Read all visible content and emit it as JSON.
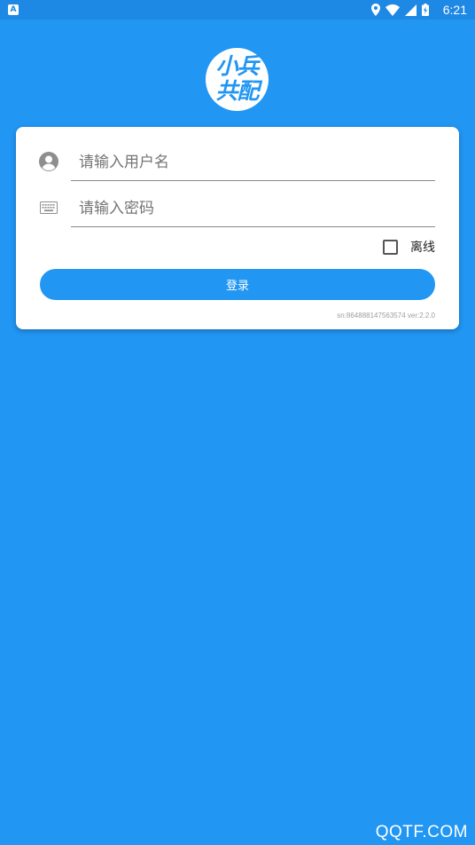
{
  "status_bar": {
    "notification_icon": "A",
    "time": "6:21",
    "icons": [
      "location-icon",
      "wifi-icon",
      "signal-icon",
      "battery-charging-icon"
    ]
  },
  "logo": {
    "line1": "小兵",
    "line2": "共配"
  },
  "login": {
    "username_placeholder": "请输入用户名",
    "password_placeholder": "请输入密码",
    "offline_label": "离线",
    "offline_checked": false,
    "submit_label": "登录",
    "sn_version": "sn:864888147563574 ver:2.2.0"
  },
  "watermark": "QQTF.COM",
  "colors": {
    "background": "#2196F3",
    "status_bar": "#1E88E5",
    "button": "#2196F3",
    "card": "#FFFFFF"
  }
}
